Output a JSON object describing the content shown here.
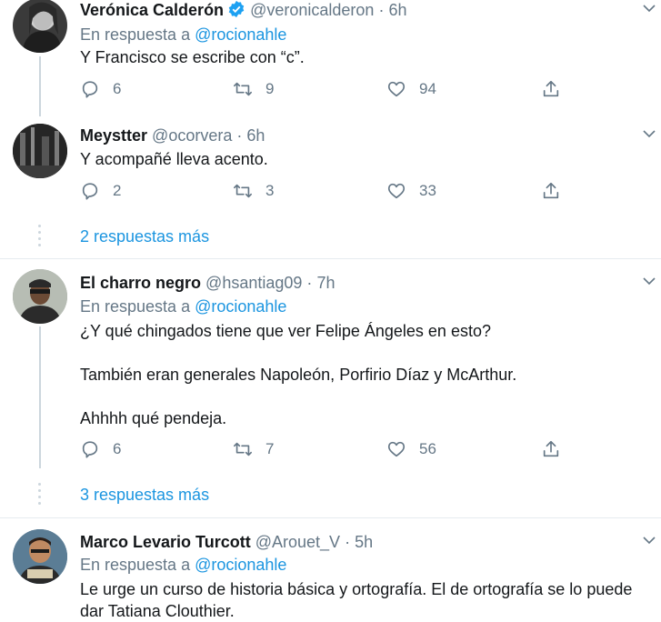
{
  "tweets": [
    {
      "name": "Verónica Calderón",
      "handle": "@veronicalderon",
      "sep": "·",
      "time": "6h",
      "verified": true,
      "reply_prefix": "En respuesta a",
      "reply_mention": "@rocionahle",
      "lines": [
        "Y Francisco se escribe con “c”."
      ],
      "replies": "6",
      "retweets": "9",
      "likes": "94"
    },
    {
      "name": "Meystter",
      "handle": "@ocorvera",
      "sep": "·",
      "time": "6h",
      "lines": [
        "Y acompañé lleva acento."
      ],
      "replies": "2",
      "retweets": "3",
      "likes": "33"
    },
    {
      "name": "El charro negro",
      "handle": "@hsantiag09",
      "sep": "·",
      "time": "7h",
      "reply_prefix": "En respuesta a",
      "reply_mention": "@rocionahle",
      "lines": [
        "¿Y qué chingados tiene que ver Felipe Ángeles en esto?",
        "También eran generales Napoleón, Porfirio Díaz y McArthur.",
        "Ahhhh qué pendeja."
      ],
      "replies": "6",
      "retweets": "7",
      "likes": "56"
    },
    {
      "name": "Marco Levario Turcott",
      "handle": "@Arouet_V",
      "sep": "·",
      "time": "5h",
      "reply_prefix": "En respuesta a",
      "reply_mention": "@rocionahle",
      "lines": [
        "Le urge un curso de historia básica y ortografía. El de ortografía se lo puede",
        "dar Tatiana Clouthier."
      ]
    }
  ],
  "more_replies": [
    "2 respuestas más",
    "3 respuestas más"
  ],
  "colors": {
    "accent": "#1b95e0",
    "secondary": "#657786",
    "text": "#14171a",
    "divider": "#e6ecf0"
  }
}
